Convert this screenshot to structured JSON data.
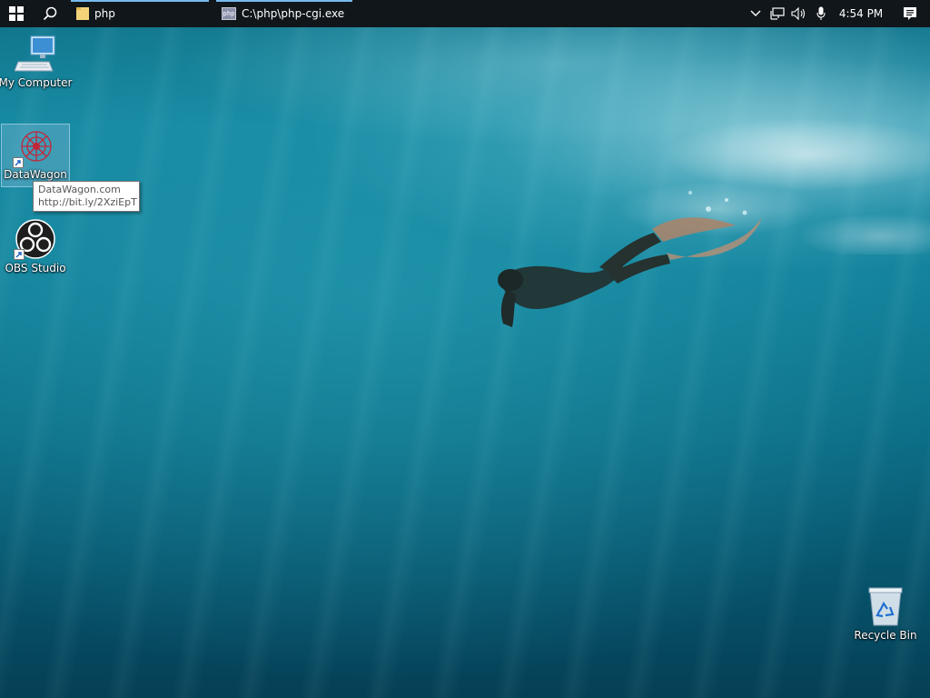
{
  "taskbar": {
    "apps": [
      {
        "label": "php",
        "icon": "folder-icon"
      },
      {
        "label": "C:\\php\\php-cgi.exe",
        "icon": "php-app-icon",
        "badge": "php"
      }
    ],
    "clock": "4:54 PM",
    "tray_icons": [
      "chevron-up-icon",
      "network-icon",
      "volume-icon",
      "microphone-icon"
    ]
  },
  "desktop": {
    "icons": [
      {
        "label": "My Computer",
        "icon": "computer-icon"
      },
      {
        "label": "DataWagon",
        "icon": "datawagon-icon",
        "selected": true
      },
      {
        "label": "OBS Studio",
        "icon": "obs-icon"
      },
      {
        "label": "Recycle Bin",
        "icon": "recycle-bin-icon"
      }
    ]
  },
  "tooltip": {
    "line1": "DataWagon.com",
    "line2": "http://bit.ly/2XziEpT"
  },
  "colors": {
    "taskbar": "#11161b",
    "active_indicator": "#76b9ed",
    "wallpaper_water": "#0f7a92"
  }
}
